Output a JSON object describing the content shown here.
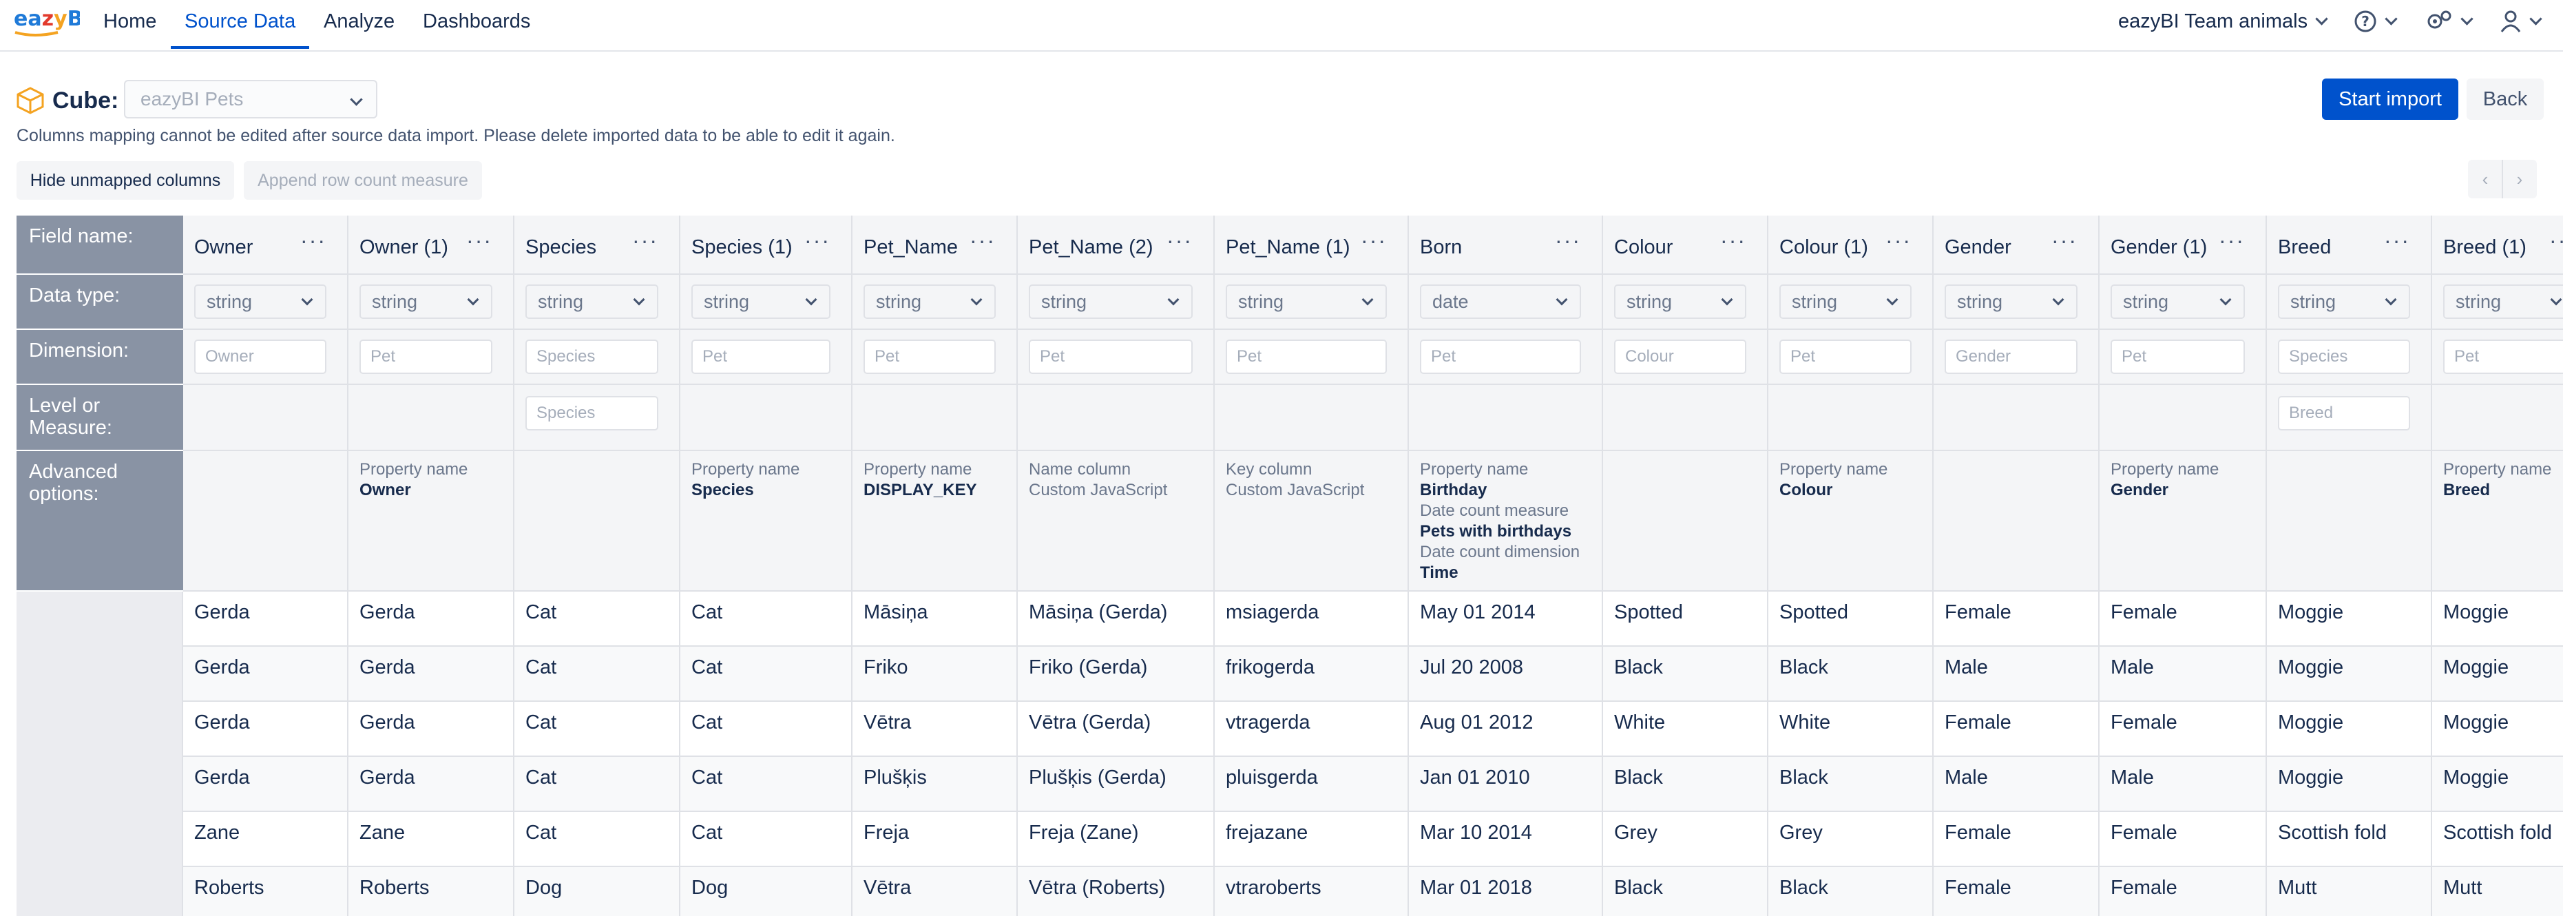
{
  "app": {
    "logo_text": "eazyBI"
  },
  "nav": {
    "home": "Home",
    "source_data": "Source Data",
    "analyze": "Analyze",
    "dashboards": "Dashboards",
    "account": "eazyBI Team animals"
  },
  "cube": {
    "label": "Cube:",
    "selected": "eazyBI Pets"
  },
  "info_text": "Columns mapping cannot be edited after source data import. Please delete imported data to be able to edit it again.",
  "buttons": {
    "start_import": "Start import",
    "back": "Back",
    "hide_unmapped": "Hide unmapped columns",
    "append_row_count": "Append row count measure"
  },
  "pager": {
    "prev": "‹",
    "next": "›"
  },
  "row_labels": {
    "field_name": "Field name:",
    "data_type": "Data type:",
    "dimension": "Dimension:",
    "level_or_measure": "Level or Measure:",
    "advanced_options": "Advanced options:"
  },
  "columns": [
    {
      "name": "Owner",
      "type": "string",
      "dimension": "Owner",
      "level": null,
      "adv": []
    },
    {
      "name": "Owner (1)",
      "type": "string",
      "dimension": "Pet",
      "level": null,
      "adv": [
        [
          "Property name",
          "n"
        ],
        [
          "Owner",
          "b"
        ]
      ]
    },
    {
      "name": "Species",
      "type": "string",
      "dimension": "Species",
      "level": "Species",
      "adv": []
    },
    {
      "name": "Species (1)",
      "type": "string",
      "dimension": "Pet",
      "level": null,
      "adv": [
        [
          "Property name",
          "n"
        ],
        [
          "Species",
          "b"
        ]
      ]
    },
    {
      "name": "Pet_Name",
      "type": "string",
      "dimension": "Pet",
      "level": null,
      "adv": [
        [
          "Property name",
          "n"
        ],
        [
          "DISPLAY_KEY",
          "b"
        ]
      ]
    },
    {
      "name": "Pet_Name (2)",
      "type": "string",
      "dimension": "Pet",
      "level": null,
      "adv": [
        [
          "Name column",
          "n"
        ],
        [
          "Custom JavaScript",
          "n"
        ]
      ]
    },
    {
      "name": "Pet_Name (1)",
      "type": "string",
      "dimension": "Pet",
      "level": null,
      "adv": [
        [
          "Key column",
          "n"
        ],
        [
          "Custom JavaScript",
          "n"
        ]
      ]
    },
    {
      "name": "Born",
      "type": "date",
      "dimension": "Pet",
      "level": null,
      "adv": [
        [
          "Property name",
          "n"
        ],
        [
          "Birthday",
          "b"
        ],
        [
          "Date count measure",
          "n"
        ],
        [
          "Pets with birthdays",
          "b"
        ],
        [
          "Date count dimension",
          "n"
        ],
        [
          "Time",
          "b"
        ]
      ]
    },
    {
      "name": "Colour",
      "type": "string",
      "dimension": "Colour",
      "level": null,
      "adv": []
    },
    {
      "name": "Colour (1)",
      "type": "string",
      "dimension": "Pet",
      "level": null,
      "adv": [
        [
          "Property name",
          "n"
        ],
        [
          "Colour",
          "b"
        ]
      ]
    },
    {
      "name": "Gender",
      "type": "string",
      "dimension": "Gender",
      "level": null,
      "adv": []
    },
    {
      "name": "Gender (1)",
      "type": "string",
      "dimension": "Pet",
      "level": null,
      "adv": [
        [
          "Property name",
          "n"
        ],
        [
          "Gender",
          "b"
        ]
      ]
    },
    {
      "name": "Breed",
      "type": "string",
      "dimension": "Species",
      "level": "Breed",
      "adv": []
    },
    {
      "name": "Breed (1)",
      "type": "string",
      "dimension": "Pet",
      "level": null,
      "adv": [
        [
          "Property name",
          "n"
        ],
        [
          "Breed",
          "b"
        ]
      ]
    }
  ],
  "rows": [
    [
      "Gerda",
      "Gerda",
      "Cat",
      "Cat",
      "Māsiņa",
      "Māsiņa (Gerda)",
      "msiagerda",
      "May 01 2014",
      "Spotted",
      "Spotted",
      "Female",
      "Female",
      "Moggie",
      "Moggie"
    ],
    [
      "Gerda",
      "Gerda",
      "Cat",
      "Cat",
      "Friko",
      "Friko (Gerda)",
      "frikogerda",
      "Jul 20 2008",
      "Black",
      "Black",
      "Male",
      "Male",
      "Moggie",
      "Moggie"
    ],
    [
      "Gerda",
      "Gerda",
      "Cat",
      "Cat",
      "Vētra",
      "Vētra (Gerda)",
      "vtragerda",
      "Aug 01 2012",
      "White",
      "White",
      "Female",
      "Female",
      "Moggie",
      "Moggie"
    ],
    [
      "Gerda",
      "Gerda",
      "Cat",
      "Cat",
      "Plušķis",
      "Plušķis (Gerda)",
      "pluisgerda",
      "Jan 01 2010",
      "Black",
      "Black",
      "Male",
      "Male",
      "Moggie",
      "Moggie"
    ],
    [
      "Zane",
      "Zane",
      "Cat",
      "Cat",
      "Freja",
      "Freja (Zane)",
      "frejazane",
      "Mar 10 2014",
      "Grey",
      "Grey",
      "Female",
      "Female",
      "Scottish fold",
      "Scottish fold"
    ],
    [
      "Roberts",
      "Roberts",
      "Dog",
      "Dog",
      "Vētra",
      "Vētra (Roberts)",
      "vtraroberts",
      "Mar 01 2018",
      "Black",
      "Black",
      "Female",
      "Female",
      "Mutt",
      "Mutt"
    ]
  ]
}
